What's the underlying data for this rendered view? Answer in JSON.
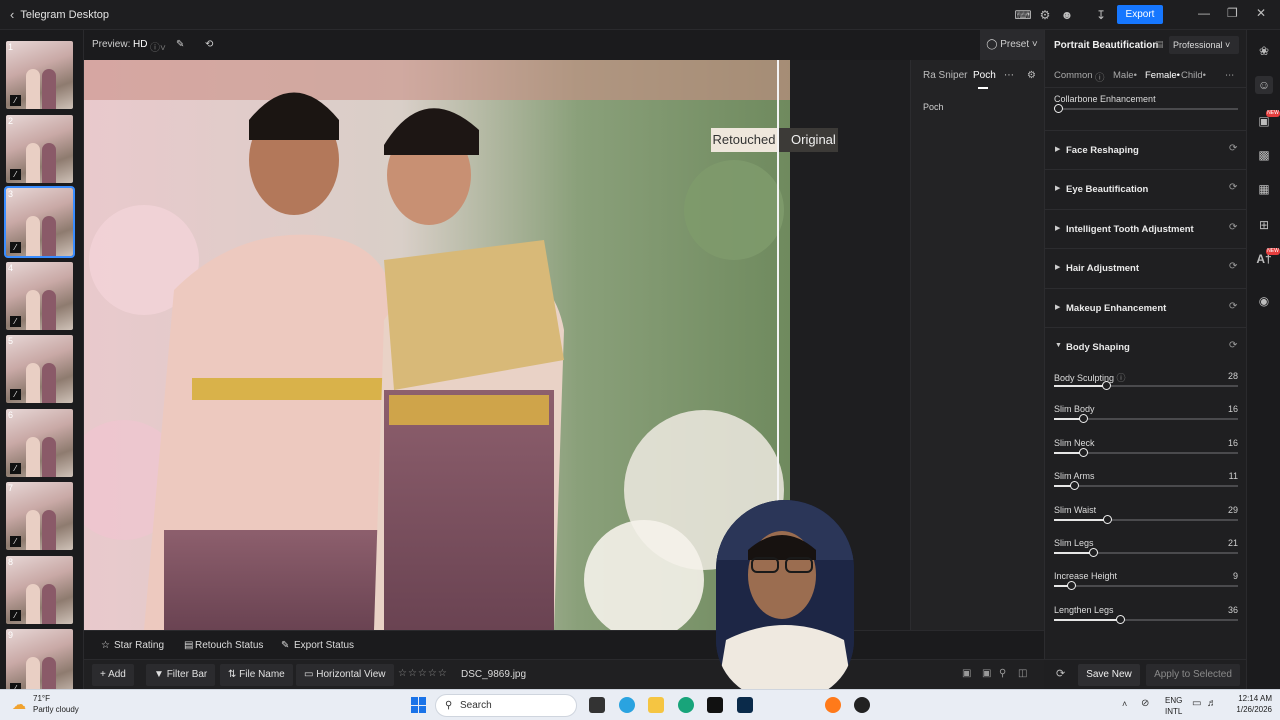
{
  "window": {
    "app_title": "Telegram Desktop",
    "export_label": "Export"
  },
  "preview": {
    "label": "Preview:",
    "quality": "HD",
    "preset_label": "Preset",
    "retouched_label": "Retouched",
    "original_label": "Original"
  },
  "filmstrip": {
    "thumbs": [
      "1",
      "2",
      "3",
      "4",
      "5",
      "6",
      "7",
      "8",
      "9"
    ],
    "selected": "3"
  },
  "midpanel": {
    "tabs": [
      "Ra Sniper",
      "Poch"
    ],
    "active_tab": "Poch",
    "item": "Poch"
  },
  "rightpanel": {
    "title": "Portrait Beautification",
    "mode": "Professional",
    "tabs": [
      "Common",
      "Male•",
      "Female•",
      "Child•"
    ],
    "active_tab": "Female•",
    "collarbone_label": "Collarbone Enhancement",
    "collarbone_value": 0,
    "sections": [
      "Face Reshaping",
      "Eye Beautification",
      "Intelligent Tooth Adjustment",
      "Hair Adjustment",
      "Makeup Enhancement",
      "Body Shaping"
    ],
    "sliders": [
      {
        "name": "Body Sculpting",
        "value": 28
      },
      {
        "name": "Slim Body",
        "value": 16
      },
      {
        "name": "Slim Neck",
        "value": 16
      },
      {
        "name": "Slim Arms",
        "value": 11
      },
      {
        "name": "Slim Waist",
        "value": 29
      },
      {
        "name": "Slim Legs",
        "value": 21
      },
      {
        "name": "Increase Height",
        "value": 9
      },
      {
        "name": "Lengthen Legs",
        "value": 36
      }
    ],
    "save_new": "Save New",
    "apply_selected": "Apply to Selected"
  },
  "statusbar": {
    "star_rating": "Star Rating",
    "retouch_status": "Retouch Status",
    "export_status": "Export Status"
  },
  "infobar": {
    "add": "Add",
    "filter_bar": "Filter Bar",
    "file_name": "File Name",
    "horizontal_view": "Horizontal View",
    "stars": "☆☆☆☆☆",
    "filename": "DSC_9869.jpg"
  },
  "taskbar": {
    "temp": "71°F",
    "weather": "Partly cloudy",
    "search": "Search",
    "lang": "ENG",
    "layout": "INTL",
    "time": "12:14 AM",
    "date": "1/26/2026"
  }
}
